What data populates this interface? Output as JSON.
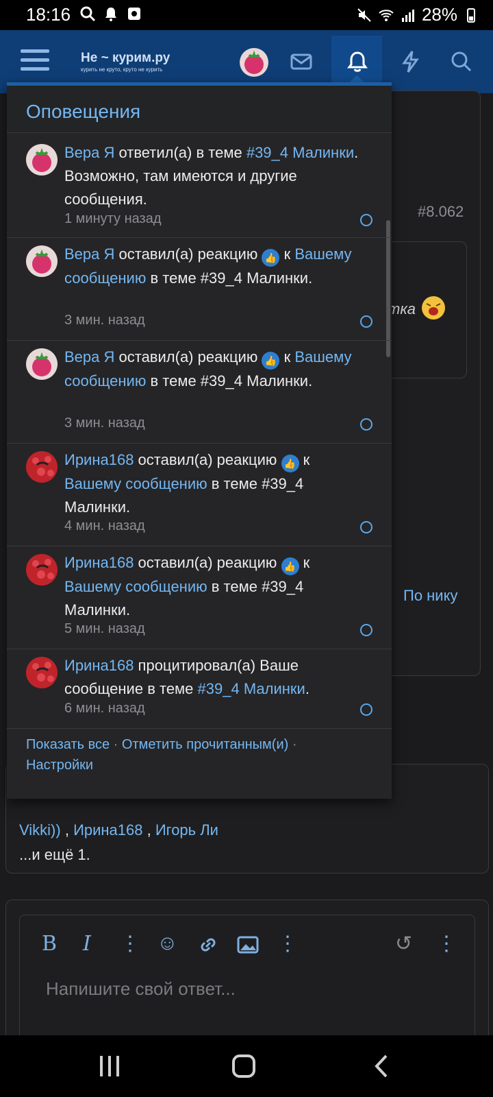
{
  "status_bar": {
    "time": "18:16",
    "battery": "28%"
  },
  "topnav": {
    "logo_title": "Не ~ курим.ру",
    "logo_tagline": "курить не круто, круто не курить"
  },
  "background": {
    "post_number": "#8.062",
    "partial_text": "тка",
    "search_by_nick": "По нику",
    "likes_line1": "Vikki))",
    "likes_sep1": " , ",
    "likes_user2": "Ирина168",
    "likes_sep2": " , ",
    "likes_user3": "Игорь Ли",
    "likes_more": "...и ещё 1."
  },
  "notifications": {
    "title": "Оповещения",
    "items": [
      {
        "user": "Вера Я",
        "action": " ответил(а) в теме ",
        "link": "#39_4 Малинки",
        "tail": ". Возможно, там имеются и другие сообщения.",
        "time": "1 минуту назад"
      },
      {
        "user": "Вера Я",
        "action": " оставил(а) реакцию ",
        "mid": " к ",
        "link": "Вашему сообщению",
        "tail": " в теме #39_4 Малинки.",
        "time": "3 мин. назад"
      },
      {
        "user": "Вера Я",
        "action": " оставил(а) реакцию ",
        "mid": " к ",
        "link": "Вашему сообщению",
        "tail": " в теме #39_4 Малинки.",
        "time": "3 мин. назад"
      },
      {
        "user": "Ирина168",
        "action": " оставил(а) реакцию ",
        "mid": " к ",
        "link": "Вашему сообщению",
        "tail": " в теме #39_4 Малинки.",
        "time": "4 мин. назад"
      },
      {
        "user": "Ирина168",
        "action": " оставил(а) реакцию ",
        "mid": " к ",
        "link": "Вашему сообщению",
        "tail": " в теме #39_4 Малинки.",
        "time": "5 мин. назад"
      },
      {
        "user": "Ирина168",
        "action": " процитировал(а) Ваше сообщение в теме ",
        "link": "#39_4 Малинки",
        "tail": ".",
        "time": "6 мин. назад"
      }
    ],
    "footer": {
      "show_all": "Показать все",
      "sep": " · ",
      "mark_read": "Отметить прочитанным(и)",
      "settings": "Настройки"
    }
  },
  "editor": {
    "placeholder": "Напишите свой ответ..."
  },
  "colors": {
    "accent": "#74b7f2",
    "nav": "#0f3d75",
    "panel": "#252527"
  }
}
